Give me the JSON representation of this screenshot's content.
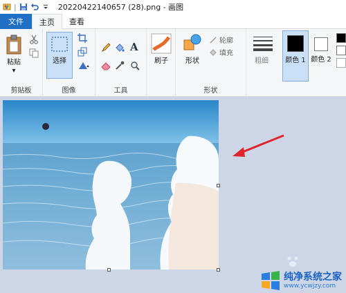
{
  "titlebar": {
    "title": "20220422140657 (28).png - 画图"
  },
  "tabs": [
    {
      "label": "文件"
    },
    {
      "label": "主页"
    },
    {
      "label": "查看"
    }
  ],
  "ribbon": {
    "clipboard": {
      "paste_label": "粘贴",
      "group_label": "剪贴板"
    },
    "image": {
      "select_label": "选择",
      "group_label": "图像"
    },
    "tools": {
      "group_label": "工具"
    },
    "brushes": {
      "label": "刷子"
    },
    "shapes": {
      "shapes_label": "形状",
      "outline_label": "轮廓",
      "fill_label": "填充",
      "group_label": "形状"
    },
    "size": {
      "label": "粗细"
    },
    "color1": {
      "label": "颜色 1"
    },
    "color2": {
      "label": "颜色 2"
    }
  },
  "watermark": {
    "line1": "纯净系统之家",
    "line2": "www.ycwjzy.com"
  },
  "colors": {
    "accent": "#1f6fc5",
    "arrow": "#e0242a",
    "canvas_bg": "#cdd6e6"
  }
}
